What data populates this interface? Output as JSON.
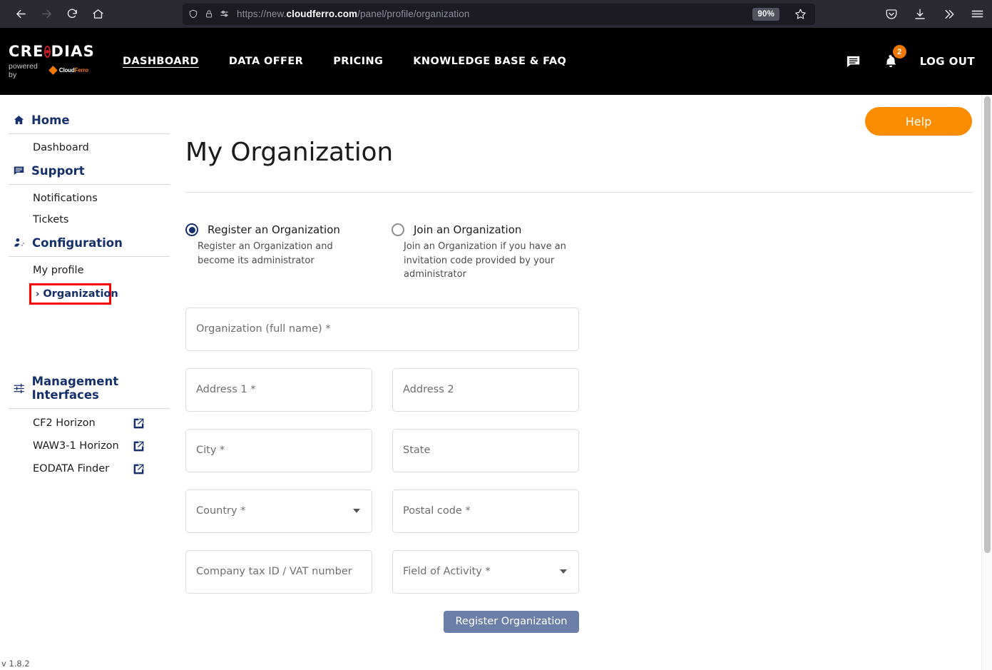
{
  "browser": {
    "back_icon": "back-arrow-icon",
    "forward_icon": "forward-arrow-icon",
    "reload_icon": "reload-icon",
    "home_icon": "home-icon",
    "shield_icon": "shield-icon",
    "lock_icon": "lock-icon",
    "permissions_icon": "page-permissions-icon",
    "url_scheme": "https://new.",
    "url_domain": "cloudferro.com",
    "url_path": "/panel/profile/organization",
    "zoom_level": "90%",
    "bookmark_icon": "star-icon",
    "pocket_icon": "pocket-icon",
    "downloads_icon": "download-icon",
    "overflow_icon": "chevron-double-right-icon",
    "menu_icon": "hamburger-menu-icon"
  },
  "header": {
    "logo_text": "CRE",
    "logo_text2": "DIAS",
    "logo_tagline": "powered by",
    "logo_partner_prefix": "Cloud",
    "logo_partner_suffix": "Ferro",
    "nav": [
      {
        "label": "DASHBOARD",
        "active": true
      },
      {
        "label": "DATA OFFER",
        "active": false
      },
      {
        "label": "PRICING",
        "active": false
      },
      {
        "label": "KNOWLEDGE BASE & FAQ",
        "active": false
      }
    ],
    "messages_icon": "message-icon",
    "notifications_icon": "bell-icon",
    "notification_count": "2",
    "logout_label": "LOG OUT"
  },
  "sidebar": {
    "groups": [
      {
        "title": "Home",
        "icon": "home-icon",
        "items": [
          {
            "label": "Dashboard"
          }
        ]
      },
      {
        "title": "Support",
        "icon": "message-icon",
        "items": [
          {
            "label": "Notifications"
          },
          {
            "label": "Tickets"
          }
        ]
      },
      {
        "title": "Configuration",
        "icon": "user-settings-icon",
        "items": [
          {
            "label": "My profile"
          }
        ],
        "active_item": {
          "label": "Organization",
          "chevron": "›"
        }
      },
      {
        "title": "Management Interfaces",
        "icon": "sliders-icon",
        "external_items": [
          {
            "label": "CF2 Horizon",
            "icon": "external-link-icon"
          },
          {
            "label": "WAW3-1 Horizon",
            "icon": "external-link-icon"
          },
          {
            "label": "EODATA Finder",
            "icon": "external-link-icon"
          }
        ]
      }
    ],
    "version": "v 1.8.2"
  },
  "main": {
    "help_label": "Help",
    "page_title": "My Organization",
    "options": [
      {
        "label": "Register an Organization",
        "description": "Register an Organization and become its administrator",
        "selected": true
      },
      {
        "label": "Join an Organization",
        "description": "Join an Organization if you have an invitation code provided by your administrator",
        "selected": false
      }
    ],
    "form": {
      "organization_name": {
        "placeholder": "Organization (full name) *",
        "value": ""
      },
      "address1": {
        "placeholder": "Address 1 *",
        "value": ""
      },
      "address2": {
        "placeholder": "Address 2",
        "value": ""
      },
      "city": {
        "placeholder": "City *",
        "value": ""
      },
      "state": {
        "placeholder": "State",
        "value": ""
      },
      "country": {
        "placeholder": "Country *",
        "value": ""
      },
      "postal_code": {
        "placeholder": "Postal code *",
        "value": ""
      },
      "vat": {
        "placeholder": "Company tax ID / VAT number",
        "value": ""
      },
      "field_of_activity": {
        "placeholder": "Field of Activity *",
        "value": ""
      },
      "submit_label": "Register Organization"
    }
  },
  "colors": {
    "brand_navy": "#16306b",
    "accent_orange": "#fa8c00",
    "logo_red": "#cc2027",
    "submit_blue": "#6b7fa8",
    "annotation_red": "#ff0000"
  }
}
